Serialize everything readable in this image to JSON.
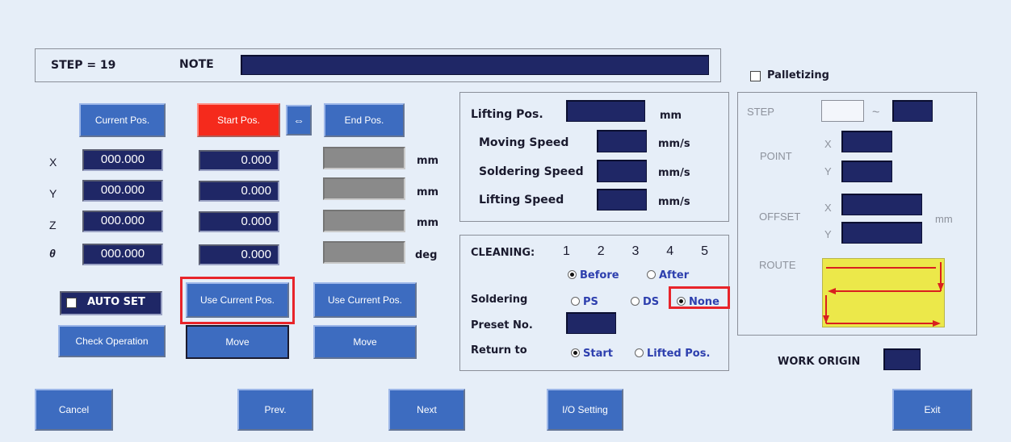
{
  "header": {
    "step_text": "STEP = 19",
    "note_label": "NOTE",
    "note_value": ""
  },
  "palletizing": {
    "label": "Palletizing",
    "checked": false
  },
  "position": {
    "current_pos_label": "Current Pos.",
    "start_pos_label": "Start Pos.",
    "swap_symbol": "⇔",
    "end_pos_label": "End Pos.",
    "rows": [
      {
        "axis": "X",
        "current": "000.000",
        "start": "0.000",
        "end": "",
        "unit": "mm"
      },
      {
        "axis": "Y",
        "current": "000.000",
        "start": "0.000",
        "end": "",
        "unit": "mm"
      },
      {
        "axis": "Z",
        "current": "000.000",
        "start": "0.000",
        "end": "",
        "unit": "mm"
      },
      {
        "axis": "θ",
        "current": "000.000",
        "start": "0.000",
        "end": "",
        "unit": "deg"
      }
    ],
    "auto_set_label": "AUTO SET",
    "use_current_pos_start": "Use Current Pos.",
    "use_current_pos_end": "Use Current Pos.",
    "check_operation": "Check Operation",
    "move_start": "Move",
    "move_end": "Move"
  },
  "lifting": {
    "lifting_pos_label": "Lifting Pos.",
    "lifting_pos_unit": "mm",
    "moving_speed_label": "Moving Speed",
    "moving_speed_unit": "mm/s",
    "soldering_speed_label": "Soldering Speed",
    "soldering_speed_unit": "mm/s",
    "lifting_speed_label": "Lifting Speed",
    "lifting_speed_unit": "mm/s"
  },
  "cleaning": {
    "label": "CLEANING:",
    "numbers": [
      "1",
      "2",
      "3",
      "4",
      "5"
    ],
    "before_label": "Before",
    "after_label": "After",
    "selected": "Before"
  },
  "soldering": {
    "label": "Soldering",
    "options": [
      "PS",
      "DS",
      "None"
    ],
    "selected": "None"
  },
  "preset": {
    "label": "Preset No."
  },
  "return_to": {
    "label": "Return to",
    "options": [
      "Start",
      "Lifted Pos."
    ],
    "selected": "Start"
  },
  "pallet_panel": {
    "step_label": "STEP",
    "tilde": "~",
    "point_label": "POINT",
    "point_x": "X",
    "point_y": "Y",
    "offset_label": "OFFSET",
    "offset_x": "X",
    "offset_y": "Y",
    "offset_unit": "mm",
    "route_label": "ROUTE"
  },
  "work_origin": {
    "label": "WORK ORIGIN"
  },
  "footer": {
    "cancel": "Cancel",
    "prev": "Prev.",
    "next": "Next",
    "io_setting": "I/O Setting",
    "exit": "Exit"
  },
  "colors": {
    "button_blue": "#3d6cc0",
    "start_red": "#f52a1c",
    "field_navy": "#1f2766",
    "route_yellow": "#ece84a",
    "highlight_red": "#e8242a"
  }
}
